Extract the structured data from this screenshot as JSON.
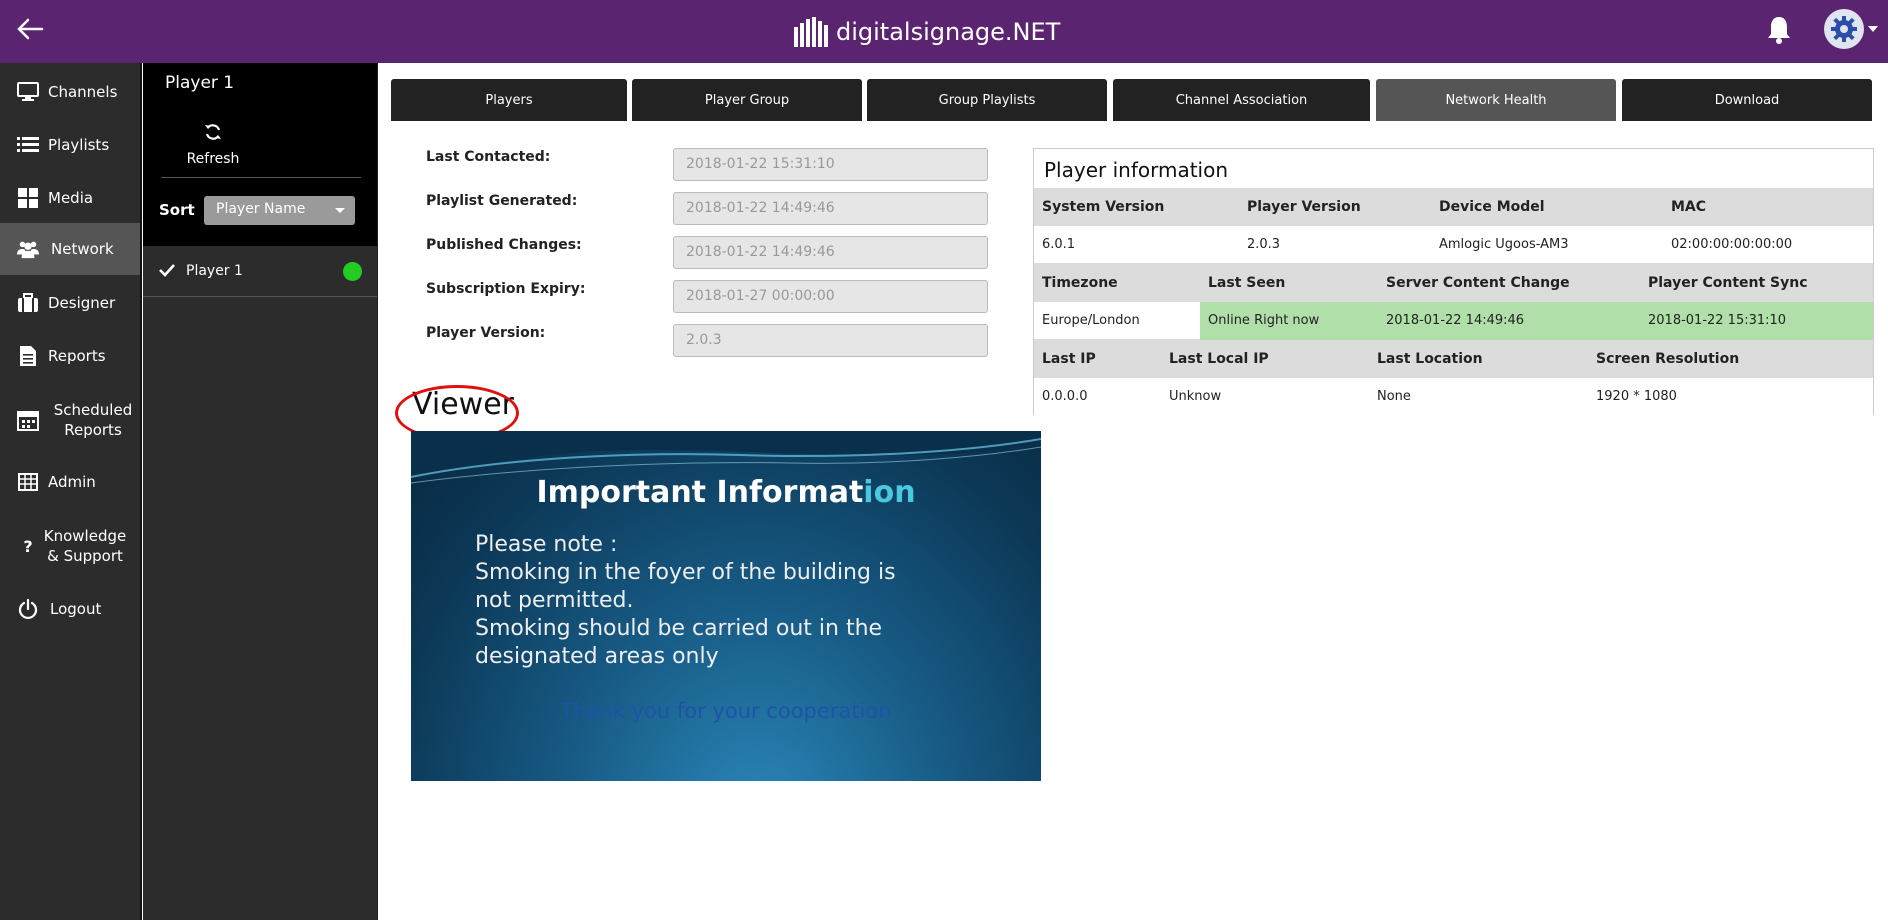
{
  "header": {
    "brand": "digitalsignage.NET"
  },
  "nav": {
    "items": [
      {
        "label": "Channels",
        "icon": "monitor-icon"
      },
      {
        "label": "Playlists",
        "icon": "list-icon"
      },
      {
        "label": "Media",
        "icon": "grid-icon"
      },
      {
        "label": "Network",
        "icon": "users-icon"
      },
      {
        "label": "Designer",
        "icon": "briefcase-icon"
      },
      {
        "label": "Reports",
        "icon": "document-icon"
      },
      {
        "label": "Scheduled Reports",
        "icon": "calendar-icon"
      },
      {
        "label": "Admin",
        "icon": "table-icon"
      },
      {
        "label": "Knowledge & Support",
        "icon": "question-icon"
      },
      {
        "label": "Logout",
        "icon": "power-icon"
      }
    ],
    "active": "Network"
  },
  "player_panel": {
    "title": "Player 1",
    "refresh_label": "Refresh",
    "sort_label": "Sort",
    "sort_value": "Player Name",
    "players": [
      {
        "name": "Player 1",
        "status_color": "#22cc22"
      }
    ]
  },
  "tabs": [
    {
      "label": "Players"
    },
    {
      "label": "Player Group"
    },
    {
      "label": "Group Playlists"
    },
    {
      "label": "Channel Association"
    },
    {
      "label": "Network Health"
    },
    {
      "label": "Download"
    }
  ],
  "active_tab": "Network Health",
  "form": {
    "last_contacted": {
      "label": "Last Contacted:",
      "value": "2018-01-22 15:31:10"
    },
    "playlist_generated": {
      "label": "Playlist Generated:",
      "value": "2018-01-22 14:49:46"
    },
    "published_changes": {
      "label": "Published Changes:",
      "value": "2018-01-22 14:49:46"
    },
    "subscription_expiry": {
      "label": "Subscription Expiry:",
      "value": "2018-01-27 00:00:00"
    },
    "player_version": {
      "label": "Player Version:",
      "value": "2.0.3"
    }
  },
  "viewer": {
    "title": "Viewer",
    "slide": {
      "title_main": "Important Informat",
      "title_highlight": "ion",
      "lines": [
        "Please note :",
        "Smoking in the foyer of the building is",
        "not permitted.",
        "Smoking should be carried out in the",
        "designated areas only"
      ],
      "thanks": "Thank you for your cooperation"
    }
  },
  "player_info": {
    "title": "Player information",
    "sections": [
      {
        "headers": [
          "System Version",
          "Player Version",
          "Device Model",
          "MAC"
        ],
        "values": [
          "6.0.1",
          "2.0.3",
          "Amlogic Ugoos-AM3",
          "02:00:00:00:00:00"
        ]
      },
      {
        "headers": [
          "Timezone",
          "Last Seen",
          "Server Content Change",
          "Player Content Sync"
        ],
        "values": [
          "Europe/London",
          "Online Right now",
          "2018-01-22 14:49:46",
          "2018-01-22 15:31:10"
        ]
      },
      {
        "headers": [
          "Last IP",
          "Last Local IP",
          "Last Location",
          "Screen Resolution"
        ],
        "values": [
          "0.0.0.0",
          "Unknow",
          "None",
          "1920 * 1080"
        ]
      }
    ]
  },
  "colors": {
    "header_bg": "#5b2470",
    "nav_bg": "#2c2c2c",
    "online_green": "#b0dfaa",
    "status_dot": "#22cc22"
  }
}
